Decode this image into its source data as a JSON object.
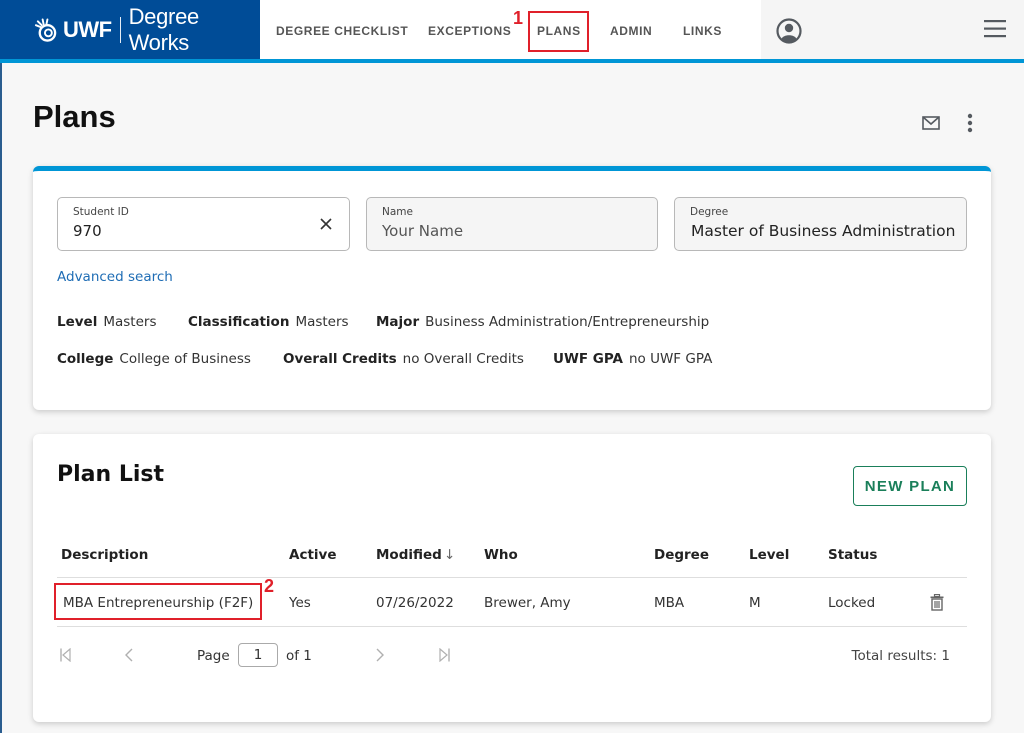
{
  "header": {
    "brand_short": "UWF",
    "brand_product": "Degree Works",
    "nav": [
      {
        "label": "DEGREE CHECKLIST"
      },
      {
        "label": "EXCEPTIONS"
      },
      {
        "label": "PLANS"
      },
      {
        "label": "ADMIN"
      },
      {
        "label": "LINKS"
      }
    ],
    "icons": {
      "profile": "user-circle-icon",
      "menu": "hamburger-menu-icon"
    }
  },
  "annotations": [
    {
      "number": "1",
      "target": "PLANS"
    },
    {
      "number": "2",
      "target": "MBA Entrepreneurship (F2F)"
    }
  ],
  "page": {
    "title": "Plans",
    "icons": {
      "email": "mail-icon",
      "more": "more-vertical-icon"
    }
  },
  "student": {
    "student_id_label": "Student ID",
    "student_id_value": "970",
    "name_label": "Name",
    "name_value": "Your Name",
    "degree_label": "Degree",
    "degree_value": "Master of Business Administration",
    "advanced_search": "Advanced search",
    "info": [
      {
        "key": "Level",
        "value": "Masters"
      },
      {
        "key": "Classification",
        "value": "Masters"
      },
      {
        "key": "Major",
        "value": "Business Administration/Entrepreneurship"
      },
      {
        "key": "College",
        "value": "College of Business"
      },
      {
        "key": "Overall Credits",
        "value": "no Overall Credits"
      },
      {
        "key": "UWF GPA",
        "value": "no UWF GPA"
      }
    ]
  },
  "plan_list": {
    "title": "Plan List",
    "new_plan_label": "NEW PLAN",
    "columns": [
      "Description",
      "Active",
      "Modified",
      "Who",
      "Degree",
      "Level",
      "Status"
    ],
    "sort_indicator": "↓",
    "rows": [
      {
        "description": "MBA Entrepreneurship (F2F)",
        "active": "Yes",
        "modified": "07/26/2022",
        "who": "Brewer, Amy",
        "degree": "MBA",
        "level": "M",
        "status": "Locked"
      }
    ],
    "pagination": {
      "page_label": "Page",
      "current_page": "1",
      "of_label": "of 1",
      "total_results": "Total results: 1"
    }
  },
  "colors": {
    "brand_blue": "#004c97",
    "accent_blue": "#0096d6",
    "link_blue": "#1f6db5",
    "new_plan_green": "#1a7f5a",
    "annotation_red": "#e0202a"
  }
}
